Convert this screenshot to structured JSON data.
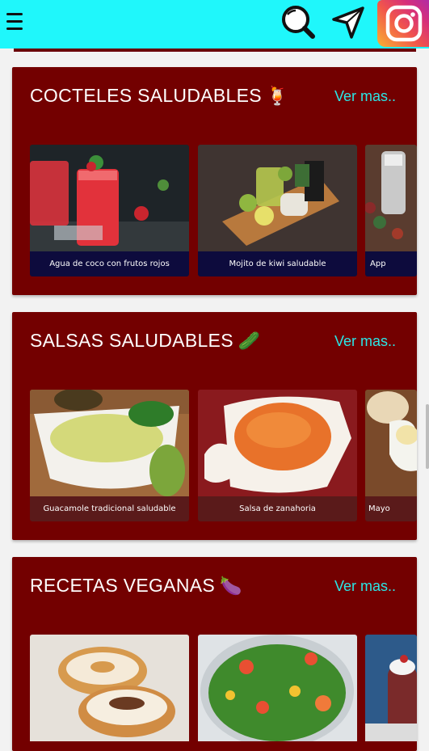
{
  "header": {
    "icons": [
      "hamburger-menu-icon",
      "search-icon",
      "navigation-arrow-icon",
      "instagram-icon"
    ],
    "colors": {
      "bar": "#1ff7fb",
      "section": "#730000",
      "link": "#2ae6e6"
    }
  },
  "sections": [
    {
      "title": "COCTELES SALUDABLES",
      "emoji": "🍹",
      "more": "Ver mas..",
      "cards": [
        {
          "caption": "Agua de coco con frutos rojos"
        },
        {
          "caption": "Mojito de kiwi saludable"
        },
        {
          "caption": "App"
        }
      ]
    },
    {
      "title": "SALSAS SALUDABLES",
      "emoji": "🥒",
      "more": "Ver mas..",
      "cards": [
        {
          "caption": "Guacamole tradicional saludable"
        },
        {
          "caption": "Salsa de zanahoria"
        },
        {
          "caption": "Mayo"
        }
      ]
    },
    {
      "title": "RECETAS VEGANAS",
      "emoji": "🍆",
      "more": "Ver mas..",
      "cards": [
        {
          "caption": ""
        },
        {
          "caption": ""
        },
        {
          "caption": ""
        }
      ]
    }
  ]
}
